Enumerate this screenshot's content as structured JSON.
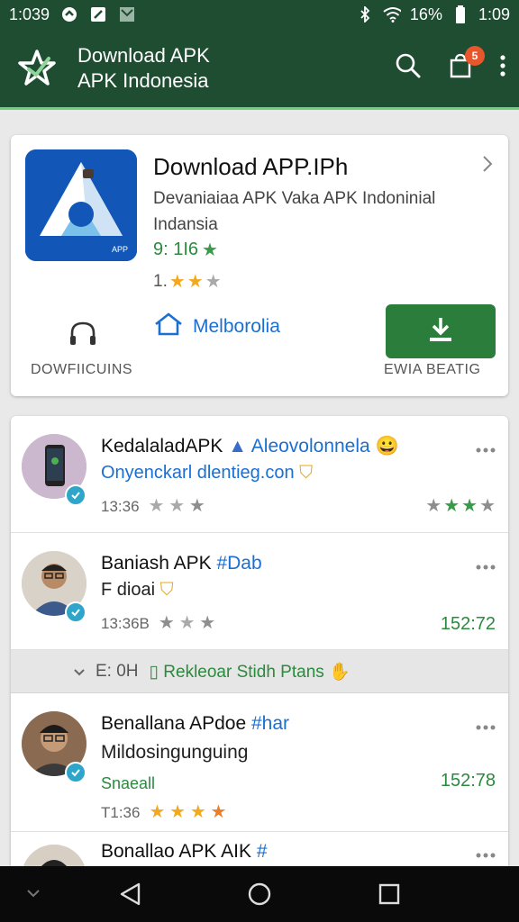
{
  "status": {
    "time_left": "1:039",
    "battery": "16%",
    "time_right": "1:09"
  },
  "appbar": {
    "title": "Download APK",
    "subtitle": "APK Indonesia",
    "cart_badge": "5"
  },
  "app": {
    "name": "Download APP.IPh",
    "description": "Devaniaiaa APK Vaka APK Indoninial Indansia",
    "rating_value": "9: 1I6",
    "rating_row_label": "1.",
    "share_label": "Melborolia",
    "downloads_label": "DOWFIICUINS",
    "install_label": "EWIA BEATIG",
    "colors": {
      "accent": "#2b7d3b",
      "brand_blue": "#1257b8"
    }
  },
  "reviews": [
    {
      "name": "KedalaladAPK",
      "tag": "Aleovolonnela",
      "sub": "Onyenckarl dlentieg.con",
      "time": "13:36",
      "icons": [
        "phone-avatar",
        "verified-icon"
      ]
    },
    {
      "name": "Baniash APK",
      "tag": "#Dab",
      "sub": "F dioai",
      "time": "13:36B",
      "right_value": "152:72"
    }
  ],
  "section": {
    "prefix": "E: 0H",
    "label": "Rekleoar Stidh Ptans"
  },
  "reviews2": [
    {
      "name": "Benallana APdoe",
      "tag": "#har",
      "line2": "Mildosingunguing",
      "sub": "Snaeall",
      "time": "T1:36",
      "right_value": "152:78"
    },
    {
      "name": "Bonallao APK AIK",
      "tag": "#"
    }
  ]
}
